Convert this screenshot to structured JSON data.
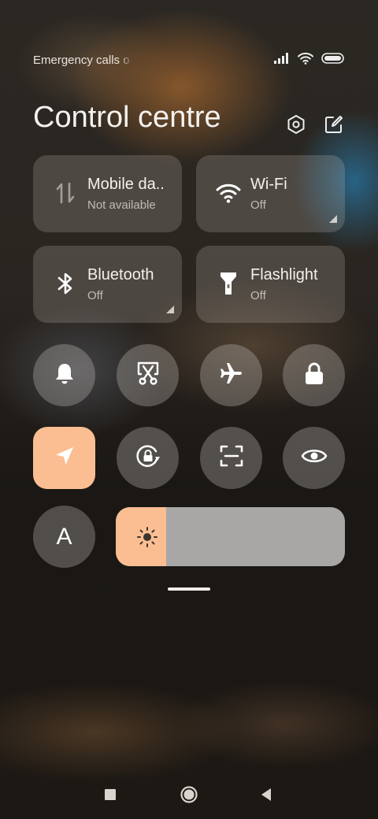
{
  "status_bar": {
    "text": "Emergency calls o",
    "icons": [
      "signal-icon",
      "wifi-icon",
      "battery-icon"
    ]
  },
  "header": {
    "title": "Control centre",
    "actions": [
      "settings-icon",
      "edit-icon"
    ]
  },
  "tiles": [
    {
      "name": "mobile-data",
      "label": "Mobile da..",
      "status": "Not available",
      "icon": "mobile-data-icon",
      "expandable": false
    },
    {
      "name": "wifi",
      "label": "Wi-Fi",
      "status": "Off",
      "icon": "wifi-icon",
      "expandable": true
    },
    {
      "name": "bluetooth",
      "label": "Bluetooth",
      "status": "Off",
      "icon": "bluetooth-icon",
      "expandable": true
    },
    {
      "name": "flashlight",
      "label": "Flashlight",
      "status": "Off",
      "icon": "flashlight-icon",
      "expandable": false
    }
  ],
  "toggles_row1": [
    "bell-icon",
    "screenshot-icon",
    "airplane-icon",
    "lock-icon"
  ],
  "toggles_row2": [
    "location-icon",
    "rotation-lock-icon",
    "scanner-icon",
    "eye-icon"
  ],
  "toggles_row2_active": [
    "location-icon"
  ],
  "auto_brightness": {
    "letter": "A",
    "icon": "auto-brightness-icon"
  },
  "brightness": {
    "level_percent": 22,
    "icon": "sun-icon"
  },
  "navigation": [
    "recents-button",
    "home-button",
    "back-button"
  ],
  "colors": {
    "accent": "#fbbe92",
    "tile_bg": "rgba(205,195,185,0.22)",
    "slider_track": "#a9a7a5"
  }
}
